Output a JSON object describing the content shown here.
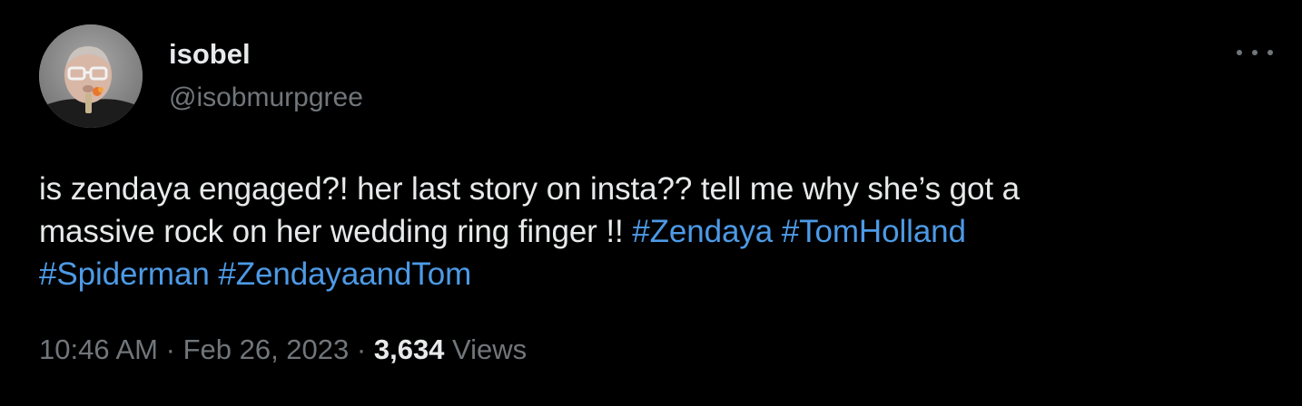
{
  "user": {
    "display_name": "isobel",
    "handle": "@isobmurpgree",
    "avatar_icon": "profile-photo"
  },
  "more_icon": "more-horizontal-icon",
  "tweet": {
    "line1": "is zendaya engaged?! her last story on insta?? tell me why she’s got a",
    "line2_text": "massive rock on her wedding ring finger !! ",
    "hashtags": [
      "#Zendaya",
      "#TomHolland",
      "#Spiderman",
      "#ZendayaandTom"
    ]
  },
  "meta": {
    "time": "10:46 AM",
    "separator": "·",
    "date": "Feb 26, 2023",
    "views_count": "3,634",
    "views_label": "Views"
  },
  "colors": {
    "background": "#000000",
    "text": "#e7e9ea",
    "secondary": "#71767b",
    "hashtag": "#4d9ae6"
  }
}
